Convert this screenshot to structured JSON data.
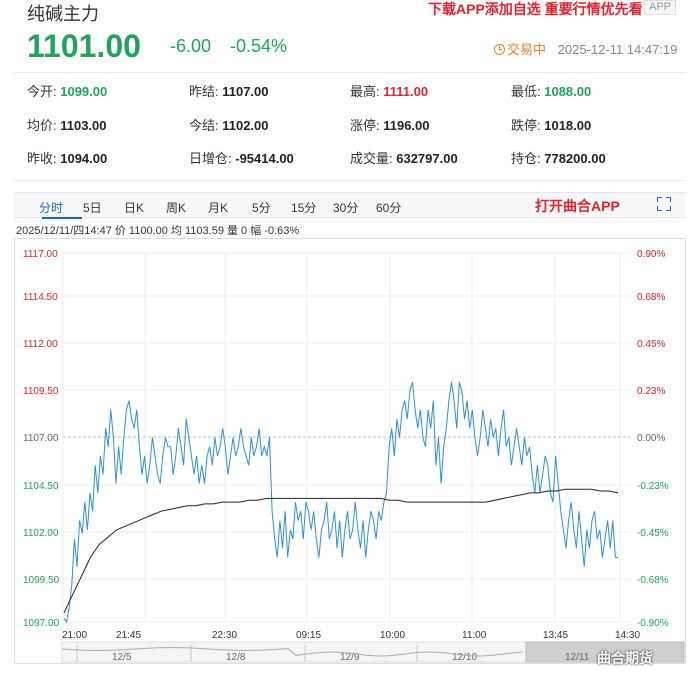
{
  "header": {
    "title": "纯碱主力",
    "promo": "下载APP添加自选 重要行情优先看",
    "app_badge": "APP",
    "price": "1101.00",
    "change": "-6.00",
    "change_pct": "-0.54%",
    "status_label": "交易中",
    "datetime": "2025-12-11 14:47:19"
  },
  "stats": [
    {
      "label": "今开:",
      "value": "1099.00",
      "color": "#21a35c"
    },
    {
      "label": "昨结:",
      "value": "1107.00",
      "color": "#222222"
    },
    {
      "label": "最高:",
      "value": "1111.00",
      "color": "#e4222b"
    },
    {
      "label": "最低:",
      "value": "1088.00",
      "color": "#21a35c"
    },
    {
      "label": "均价:",
      "value": "1103.00",
      "color": "#222222"
    },
    {
      "label": "今结:",
      "value": "1102.00",
      "color": "#222222"
    },
    {
      "label": "涨停:",
      "value": "1196.00",
      "color": "#222222"
    },
    {
      "label": "跌停:",
      "value": "1018.00",
      "color": "#222222"
    },
    {
      "label": "昨收:",
      "value": "1094.00",
      "color": "#222222"
    },
    {
      "label": "日增仓:",
      "value": "-95414.00",
      "color": "#222222"
    },
    {
      "label": "成交量:",
      "value": "632797.00",
      "color": "#222222"
    },
    {
      "label": "持仓:",
      "value": "778200.00",
      "color": "#222222"
    }
  ],
  "tabs": [
    "分时",
    "5日",
    "日K",
    "周K",
    "月K",
    "5分",
    "15分",
    "30分",
    "60分"
  ],
  "open_app": "打开曲合APP",
  "info_line": "2025/12/11/四14:47  价 1100.00  均 1103.59  量 0  幅 -0.63%",
  "watermark": "曲合期货",
  "colors": {
    "green": "#21a35c",
    "red": "#e4222b",
    "price_line": "#2f8fd6",
    "avg_line": "#222222"
  },
  "chart_data": {
    "type": "line",
    "y_left_ticks": [
      "1117.00",
      "1114.50",
      "1112.00",
      "1109.50",
      "1107.00",
      "1104.50",
      "1102.00",
      "1099.50",
      "1097.00"
    ],
    "y_right_ticks": [
      "0.90%",
      "0.68%",
      "0.45%",
      "0.23%",
      "0.00%",
      "-0.23%",
      "-0.45%",
      "-0.68%",
      "-0.90%"
    ],
    "ylim": [
      1097,
      1117
    ],
    "prev_settle": 1107,
    "x_ticks": [
      "21:00",
      "21:45",
      "22:30",
      "09:15",
      "10:00",
      "11:00",
      "13:45",
      "14:30"
    ],
    "nav_labels": [
      "12/5",
      "12/8",
      "12/9",
      "12/10",
      "12/11"
    ],
    "series": [
      {
        "values": [
          1097.2,
          1097.0,
          1097.8,
          1099.0,
          1101.5,
          1100.0,
          1102.5,
          1101.8,
          1103.5,
          1102.0,
          1104.0,
          1103.0,
          1105.5,
          1104.0,
          1106.0,
          1105.0,
          1107.5,
          1106.5,
          1108.5,
          1107.0,
          1104.5,
          1106.5,
          1105.0,
          1107.0,
          1108.5,
          1109.0,
          1108.0,
          1107.5,
          1108.5,
          1106.5,
          1105.0,
          1106.0,
          1104.5,
          1105.5,
          1107.0,
          1106.0,
          1105.0,
          1104.5,
          1106.0,
          1107.0,
          1106.5,
          1106.5,
          1105.0,
          1106.0,
          1107.5,
          1106.5,
          1105.5,
          1108.0,
          1107.0,
          1106.0,
          1105.0,
          1106.0,
          1104.5,
          1105.5,
          1104.5,
          1106.0,
          1106.5,
          1105.5,
          1107.0,
          1106.0,
          1106.5,
          1107.5,
          1106.5,
          1105.0,
          1106.0,
          1107.0,
          1106.0,
          1106.5,
          1107.5,
          1106.5,
          1106.0,
          1105.5,
          1107.0,
          1106.0,
          1106.5,
          1107.5,
          1106.0,
          1106.5,
          1106.0,
          1107.0,
          1103.0,
          1101.5,
          1100.5,
          1102.5,
          1101.0,
          1103.0,
          1100.5,
          1102.0,
          1101.5,
          1103.5,
          1102.5,
          1103.0,
          1101.5,
          1103.5,
          1103.0,
          1102.0,
          1103.0,
          1101.5,
          1100.5,
          1102.0,
          1102.5,
          1103.5,
          1101.5,
          1102.0,
          1103.0,
          1101.0,
          1102.5,
          1100.5,
          1102.0,
          1103.0,
          1101.5,
          1102.0,
          1103.5,
          1102.0,
          1101.0,
          1102.5,
          1100.5,
          1102.0,
          1103.0,
          1102.5,
          1101.5,
          1103.0,
          1102.5,
          1103.5,
          1104.0,
          1106.5,
          1107.5,
          1106.0,
          1108.0,
          1107.0,
          1108.5,
          1109.0,
          1108.0,
          1109.5,
          1110.0,
          1108.5,
          1107.5,
          1108.5,
          1107.0,
          1106.5,
          1108.5,
          1107.5,
          1109.0,
          1105.5,
          1107.0,
          1104.5,
          1106.5,
          1107.5,
          1109.0,
          1110.0,
          1109.0,
          1107.5,
          1110.0,
          1109.5,
          1108.0,
          1109.0,
          1107.5,
          1108.5,
          1107.0,
          1106.0,
          1107.0,
          1108.5,
          1107.5,
          1106.5,
          1108.0,
          1107.0,
          1107.5,
          1106.0,
          1107.5,
          1108.5,
          1106.5,
          1107.0,
          1105.5,
          1106.5,
          1107.5,
          1106.5,
          1105.5,
          1107.0,
          1106.0,
          1106.5,
          1105.0,
          1104.0,
          1105.5,
          1104.0,
          1105.0,
          1106.0,
          1105.5,
          1104.0,
          1103.5,
          1106.0,
          1104.5,
          1103.0,
          1102.0,
          1101.0,
          1102.5,
          1103.5,
          1102.0,
          1101.0,
          1103.0,
          1101.5,
          1100.0,
          1102.0,
          1101.0,
          1102.5,
          1103.0,
          1101.5,
          1102.0,
          1100.5,
          1101.5,
          1102.5,
          1101.0,
          1102.5,
          1100.5,
          1100.5
        ]
      },
      {
        "values": [
          1097.5,
          1098.5,
          1099.5,
          1100.5,
          1101.2,
          1101.6,
          1102.0,
          1102.2,
          1102.4,
          1102.6,
          1102.8,
          1103.0,
          1103.1,
          1103.2,
          1103.3,
          1103.3,
          1103.4,
          1103.4,
          1103.5,
          1103.5,
          1103.5,
          1103.6,
          1103.6,
          1103.7,
          1103.7,
          1103.7,
          1103.7,
          1103.7,
          1103.7,
          1103.7,
          1103.7,
          1103.7,
          1103.7,
          1103.7,
          1103.7,
          1103.7,
          1103.7,
          1103.6,
          1103.6,
          1103.5,
          1103.5,
          1103.5,
          1103.5,
          1103.5,
          1103.5,
          1103.5,
          1103.5,
          1103.5,
          1103.5,
          1103.6,
          1103.7,
          1103.8,
          1103.9,
          1104.0,
          1104.0,
          1104.1,
          1104.1,
          1104.2,
          1104.2,
          1104.2,
          1104.2,
          1104.1,
          1104.1,
          1104.0
        ]
      }
    ]
  }
}
